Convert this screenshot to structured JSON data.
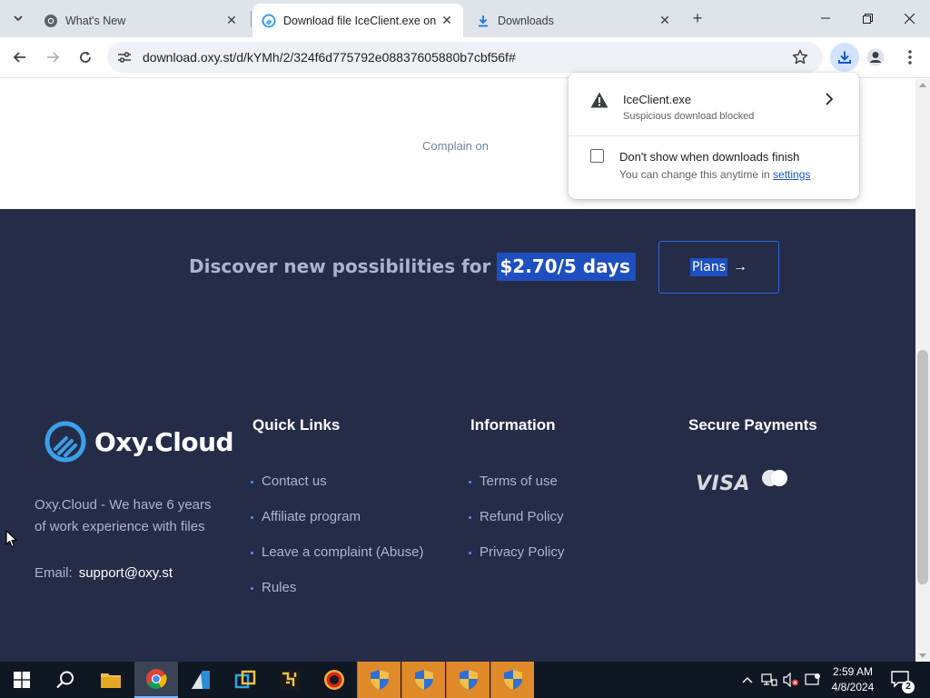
{
  "browser": {
    "tabs": [
      {
        "title": "What's New",
        "favicon": "chrome-icon",
        "active": false
      },
      {
        "title": "Download file IceClient.exe on (",
        "favicon": "oxycloud-icon",
        "active": true
      },
      {
        "title": "Downloads",
        "favicon": "download-icon",
        "active": false
      }
    ],
    "url": "download.oxy.st/d/kYMh/2/324f6d775792e08837605880b7cbf56f#"
  },
  "download_bubble": {
    "filename": "IceClient.exe",
    "status": "Suspicious download blocked",
    "option_label": "Don't show when downloads finish",
    "option_checked": false,
    "hint_prefix": "You can change this anytime in ",
    "hint_link": "settings"
  },
  "page": {
    "complain_text": "Complain on",
    "promo": {
      "text": "Discover new possibilities for ",
      "price": "$2.70/5 days"
    },
    "plans_button": "Plans",
    "footer": {
      "brand": "Oxy.Cloud",
      "about": "Oxy.Cloud - We have 6 years of work experience with files",
      "email_label": "Email:",
      "email": "support@oxy.st",
      "quick_links": {
        "title": "Quick Links",
        "items": [
          "Contact us",
          "Affiliate program",
          "Leave a complaint (Abuse)",
          "Rules"
        ]
      },
      "information": {
        "title": "Information",
        "items": [
          "Terms of use",
          "Refund Policy",
          "Privacy Policy"
        ]
      },
      "payments": {
        "title": "Secure Payments",
        "visa": "VISA"
      }
    }
  },
  "taskbar": {
    "pinned": [
      "start-icon",
      "search-icon",
      "file-explorer-icon",
      "chrome-icon",
      "app-icon",
      "app-icon",
      "app-icon",
      "app-icon",
      "shield-icon",
      "shield-icon",
      "shield-icon",
      "shield-icon"
    ],
    "time": "2:59 AM",
    "date": "4/8/2024",
    "notification_count": "2"
  },
  "colors": {
    "footer_bg": "#252c48",
    "accent_blue": "#1d4fc1",
    "taskbar_bg": "#0f1723",
    "taskbar_highlight": "#e08a2a"
  }
}
